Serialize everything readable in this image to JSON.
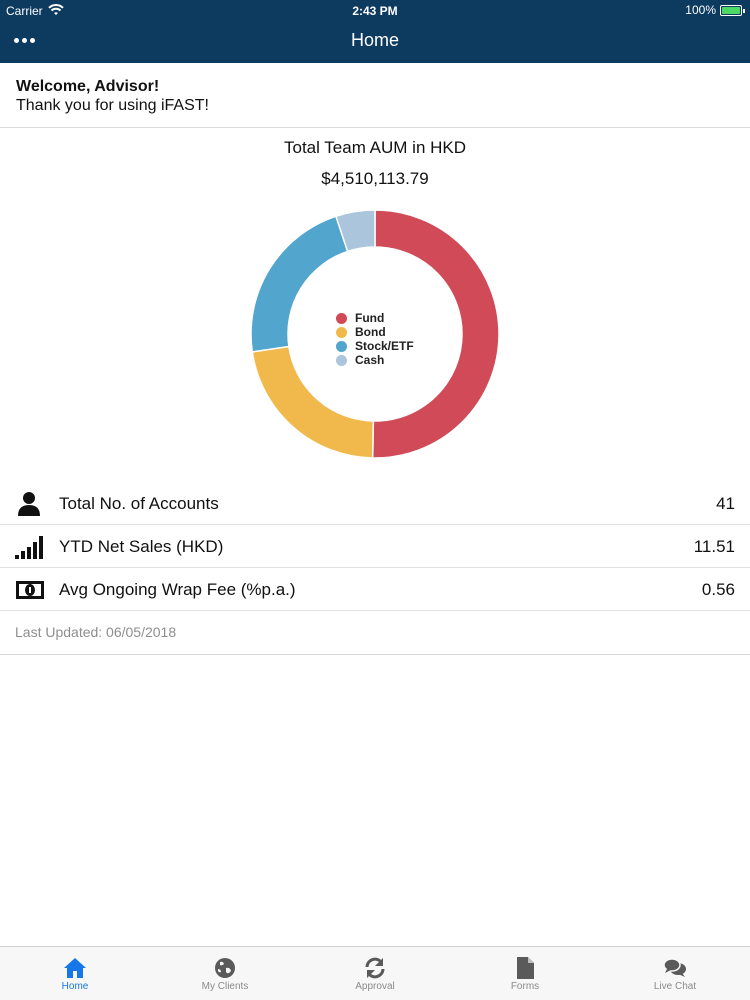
{
  "status_bar": {
    "carrier": "Carrier",
    "time": "2:43 PM",
    "battery": "100%"
  },
  "nav": {
    "title": "Home",
    "menu_icon": "more-dots-icon"
  },
  "welcome": {
    "title": "Welcome, Advisor!",
    "subtitle": "Thank you for using iFAST!"
  },
  "chart_data": {
    "type": "pie",
    "style": "donut",
    "title": "Total Team AUM in HKD",
    "total": "$4,510,113.79",
    "legend_placement": "center",
    "series": [
      {
        "name": "Fund",
        "value": 0.503,
        "color": "#d04a58"
      },
      {
        "name": "Bond",
        "value": 0.224,
        "color": "#f1b94b"
      },
      {
        "name": "Stock/ETF",
        "value": 0.222,
        "color": "#52a5cd"
      },
      {
        "name": "Cash",
        "value": 0.051,
        "color": "#abc5dc"
      }
    ]
  },
  "metrics": [
    {
      "icon": "user-icon",
      "label": "Total No. of Accounts",
      "value": "41"
    },
    {
      "icon": "signal-bars-icon",
      "label": "YTD Net Sales (HKD)",
      "value": "11.51"
    },
    {
      "icon": "banknote-icon",
      "label": "Avg Ongoing Wrap Fee (%p.a.)",
      "value": "0.56"
    }
  ],
  "last_updated": "Last Updated: 06/05/2018",
  "tabs": [
    {
      "label": "Home",
      "icon": "home-icon",
      "active": true
    },
    {
      "label": "My Clients",
      "icon": "globe-icon",
      "active": false
    },
    {
      "label": "Approval",
      "icon": "refresh-icon",
      "active": false
    },
    {
      "label": "Forms",
      "icon": "document-icon",
      "active": false
    },
    {
      "label": "Live Chat",
      "icon": "chat-bubbles-icon",
      "active": false
    }
  ],
  "colors": {
    "header": "#0d3a5f",
    "active_tab": "#1677e8",
    "inactive_tab": "#8a8a8a",
    "battery": "#4cd964"
  }
}
